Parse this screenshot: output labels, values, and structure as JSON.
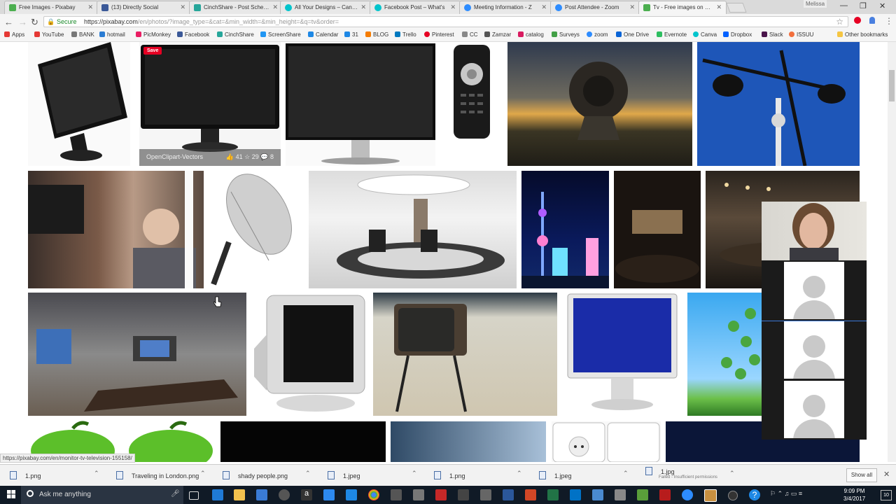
{
  "browser": {
    "tabs": [
      {
        "label": "Free Images - Pixabay",
        "color": "#4caf50"
      },
      {
        "label": "(13) Directly Social",
        "color": "#3b5998"
      },
      {
        "label": "CinchShare - Post Schedu",
        "color": "#26a69a"
      },
      {
        "label": "All Your Designs – Canva",
        "color": "#00c4cc"
      },
      {
        "label": "Facebook Post – What's",
        "color": "#00c4cc"
      },
      {
        "label": "Meeting Information - Z",
        "color": "#2d8cff"
      },
      {
        "label": "Post Attendee - Zoom",
        "color": "#2d8cff"
      },
      {
        "label": "Tv - Free images on Pixa",
        "color": "#4caf50"
      }
    ],
    "window_user": "Melissa",
    "address": {
      "secure_label": "Secure",
      "url_host": "https://pixabay.com",
      "url_path": "/en/photos/?image_type=&cat=&min_width=&min_height=&q=tv&order="
    },
    "bookmarks": [
      {
        "label": "Apps",
        "color": "#e53935"
      },
      {
        "label": "YouTube",
        "color": "#e53935"
      },
      {
        "label": "BANK",
        "color": "#555"
      },
      {
        "label": "hotmail",
        "color": "#2b7cd3"
      },
      {
        "label": "PicMonkey",
        "color": "#e91e63"
      },
      {
        "label": "Facebook",
        "color": "#3b5998"
      },
      {
        "label": "CinchShare",
        "color": "#26a69a"
      },
      {
        "label": "ScreenShare",
        "color": "#2196f3"
      },
      {
        "label": "Calendar",
        "color": "#1e88e5"
      },
      {
        "label": "31",
        "color": "#1e88e5"
      },
      {
        "label": "BLOG",
        "color": "#f57c00"
      },
      {
        "label": "Trello",
        "color": "#0079bf"
      },
      {
        "label": "Pinterest",
        "color": "#e60023"
      },
      {
        "label": "CC",
        "color": "#888"
      },
      {
        "label": "Zamzar",
        "color": "#555"
      },
      {
        "label": "catalog",
        "color": "#d81b60"
      },
      {
        "label": "Surveys",
        "color": "#43a047"
      },
      {
        "label": "zoom",
        "color": "#2d8cff"
      },
      {
        "label": "One Drive",
        "color": "#0a64d6"
      },
      {
        "label": "Evernote",
        "color": "#2dbe60"
      },
      {
        "label": "Canva",
        "color": "#00c4cc"
      },
      {
        "label": "Dropbox",
        "color": "#0061ff"
      },
      {
        "label": "Slack",
        "color": "#4a154b"
      },
      {
        "label": "ISSUU",
        "color": "#f26f3d"
      },
      {
        "label": "Other bookmarks",
        "color": "#f5c542"
      }
    ]
  },
  "gallery": {
    "hover_card": {
      "save_label": "Save",
      "author": "OpenClipart-Vectors",
      "likes": "41",
      "favorites": "29",
      "comments": "8"
    }
  },
  "status_url": "https://pixabay.com/en/monitor-tv-television-155158/",
  "downloads": {
    "items": [
      {
        "name": "1.png",
        "sub": ""
      },
      {
        "name": "Traveling in London.png",
        "sub": ""
      },
      {
        "name": "shady people.png",
        "sub": ""
      },
      {
        "name": "1.jpeg",
        "sub": ""
      },
      {
        "name": "1.png",
        "sub": ""
      },
      {
        "name": "1.jpeg",
        "sub": ""
      },
      {
        "name": "1.jpg",
        "sub": "Failed - Insufficient permissions"
      }
    ],
    "show_all_label": "Show all"
  },
  "taskbar": {
    "search_placeholder": "Ask me anything",
    "time": "9:09 PM",
    "date": "3/4/2017",
    "notifications": "10"
  }
}
